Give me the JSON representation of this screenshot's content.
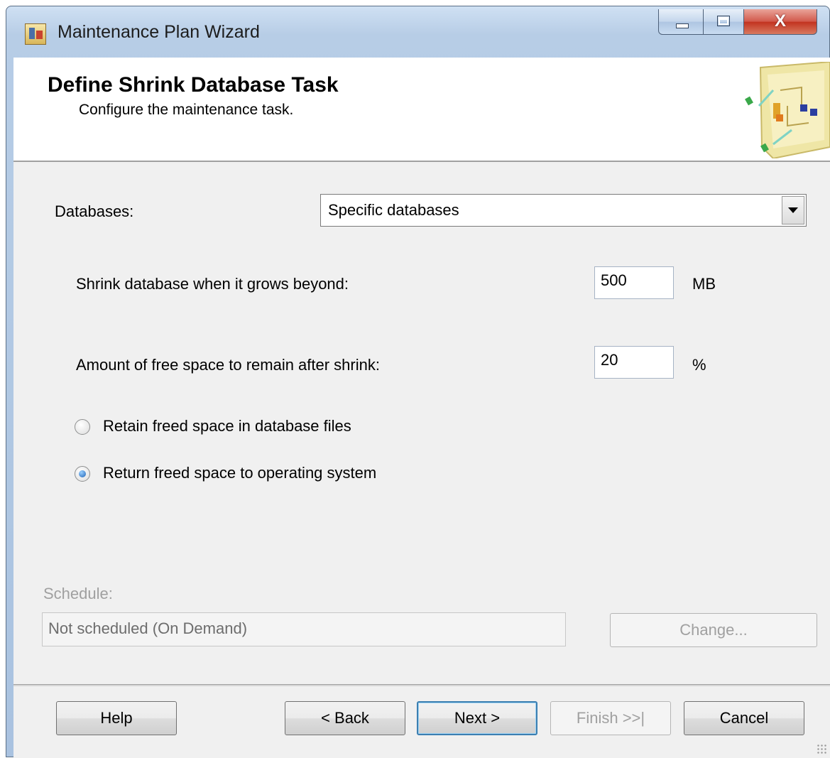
{
  "window": {
    "title": "Maintenance Plan Wizard",
    "close_glyph": "X"
  },
  "header": {
    "title": "Define Shrink Database Task",
    "subtitle": "Configure the maintenance task."
  },
  "form": {
    "databases": {
      "label": "Databases:",
      "value": "Specific databases"
    },
    "shrink_threshold": {
      "label": "Shrink database when it grows beyond:",
      "value": "500",
      "unit": "MB"
    },
    "free_space": {
      "label": "Amount of free space to remain after shrink:",
      "value": "20",
      "unit": "%"
    },
    "radio_retain": {
      "label": "Retain freed space in database files",
      "checked": false
    },
    "radio_return": {
      "label": "Return freed space to operating system",
      "checked": true
    }
  },
  "schedule": {
    "label": "Schedule:",
    "value": "Not scheduled (On Demand)",
    "change_button": "Change..."
  },
  "buttons": {
    "help": "Help",
    "back": "< Back",
    "next": "Next >",
    "finish": "Finish >>|",
    "cancel": "Cancel"
  },
  "colors": {
    "title_bar": "#b7cde6",
    "dialog_background": "#f0f0f0",
    "close_button": "#c2321f",
    "default_button_border": "#3c7fb1"
  },
  "icons": {
    "app": "maintenance-plan-icon",
    "wizard": "wizard-graphic-icon",
    "minimize": "minimize-icon",
    "maximize": "maximize-icon",
    "close": "close-icon",
    "dropdown": "chevron-down-icon"
  }
}
